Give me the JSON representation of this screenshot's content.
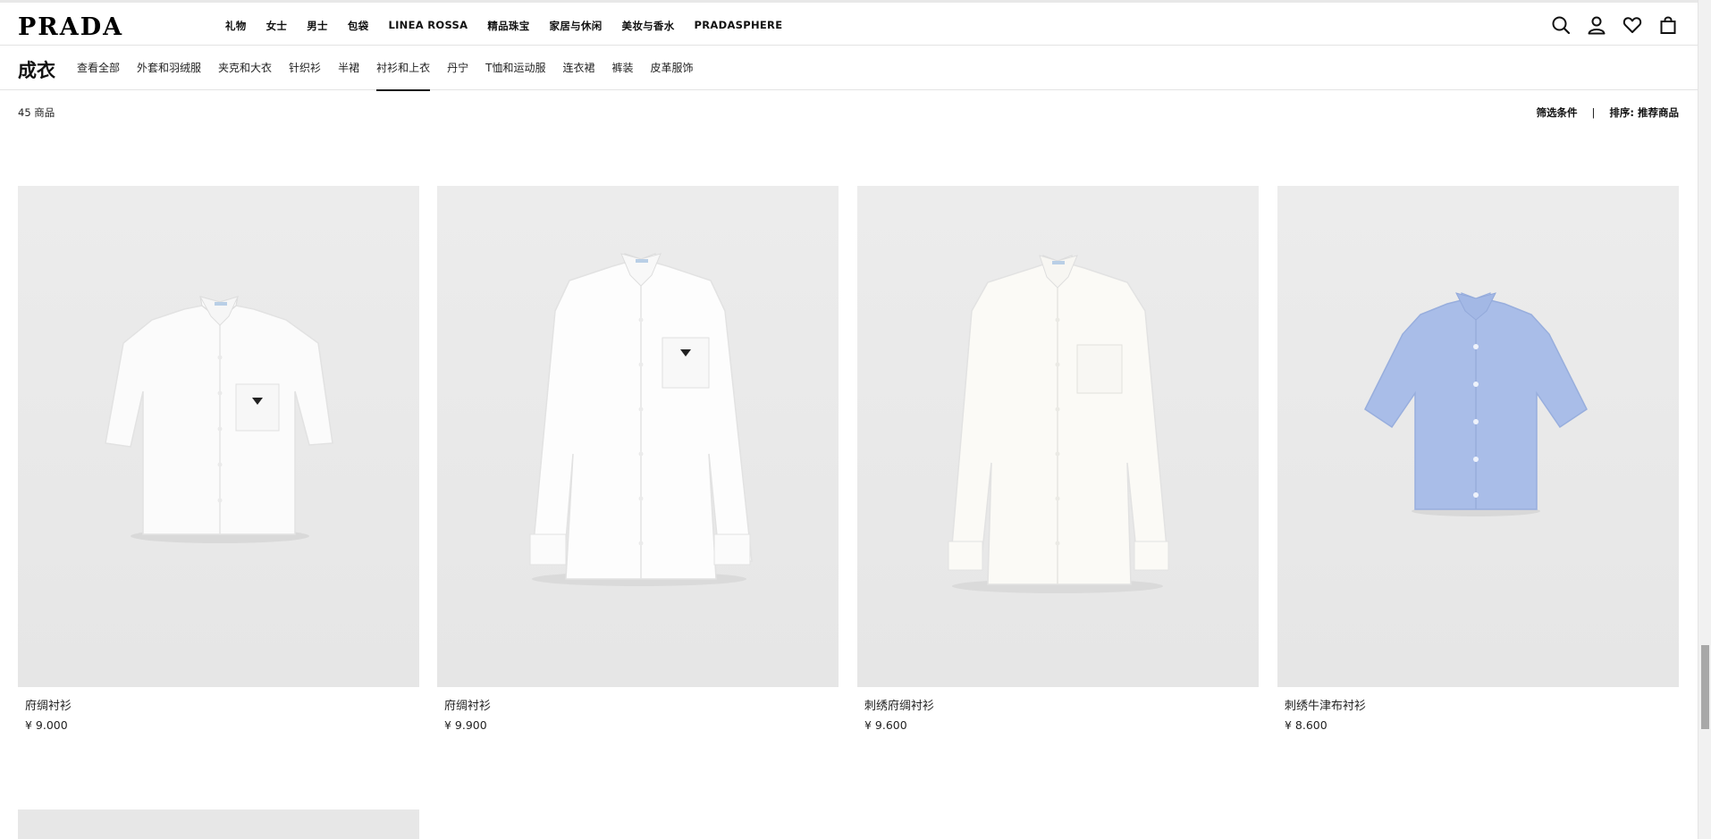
{
  "brand": {
    "logo_text": "PRADA"
  },
  "main_nav": [
    "礼物",
    "女士",
    "男士",
    "包袋",
    "LINEA ROSSA",
    "精品珠宝",
    "家居与休闲",
    "美妆与香水",
    "PRADASPHERE"
  ],
  "header_icons": [
    "search-icon",
    "account-icon",
    "wishlist-heart-icon",
    "shopping-bag-icon"
  ],
  "section": {
    "title": "成衣",
    "subnav": [
      "查看全部",
      "外套和羽绒服",
      "夹克和大衣",
      "针织衫",
      "半裙",
      "衬衫和上衣",
      "丹宁",
      "T恤和运动服",
      "连衣裙",
      "裤装",
      "皮革服饰"
    ],
    "active_index": 5
  },
  "results": {
    "count": "45 商品",
    "filter_label": "筛选条件",
    "divider": "|",
    "sort_label": "排序: 推荐商品"
  },
  "products": [
    {
      "name": "府绸衬衫",
      "price": "¥ 9.000",
      "image": "white-short-sleeve-cropped-shirt"
    },
    {
      "name": "府绸衬衫",
      "price": "¥ 9.900",
      "image": "white-long-sleeve-shirt"
    },
    {
      "name": "刺绣府绸衬衫",
      "price": "¥ 9.600",
      "image": "off-white-long-sleeve-shirt"
    },
    {
      "name": "刺绣牛津布衬衫",
      "price": "¥ 8.600",
      "image": "light-blue-short-sleeve-shirt"
    }
  ],
  "colors": {
    "image_bg": "#e8e8e8",
    "text": "#111111",
    "shirt_blue": "#a9bde8"
  }
}
